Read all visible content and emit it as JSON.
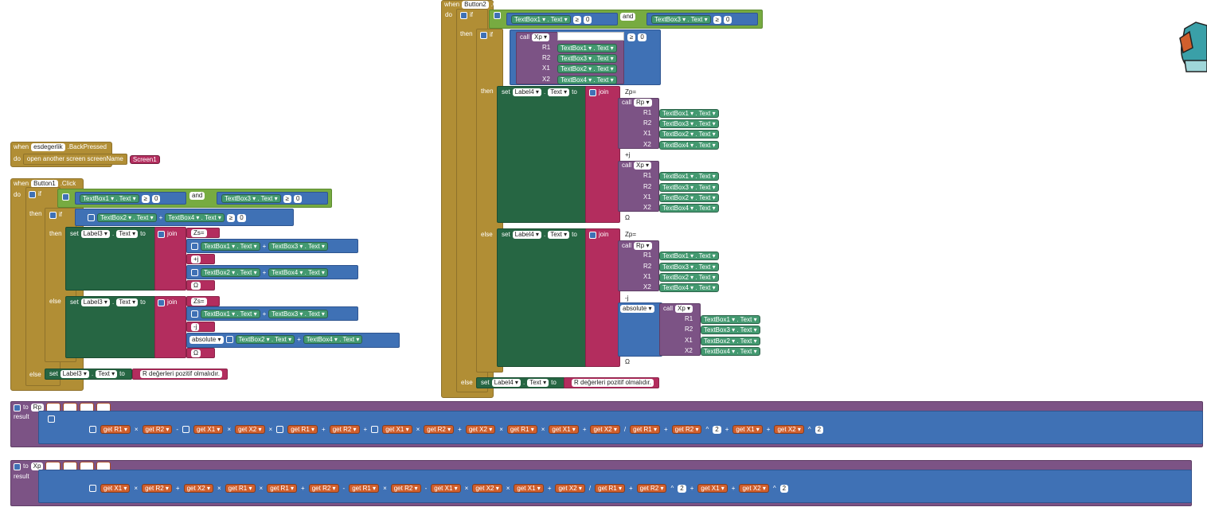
{
  "kw": {
    "when": "when",
    "do": "do",
    "if": "if",
    "then": "then",
    "else": "else",
    "set": "set",
    "to": "to",
    "join": "join",
    "call": "call",
    "result": "result",
    "and": "and",
    "gte": "≥",
    "plus": "+",
    "minus": "-",
    "times": "×",
    "div": "/",
    "pow": "^",
    "get": "get",
    "absolute": "absolute",
    "text": "Text",
    "dot": ".",
    "zero": "0",
    "two": "2",
    "open_screen": "open another screen  screenName",
    "screen1": "Screen1"
  },
  "events": {
    "back": {
      "component": "esdegerlik",
      "event": ".BackPressed"
    },
    "b1": {
      "component": "Button1",
      "event": ".Click"
    },
    "b2": {
      "component": "Button2",
      "event": ".Click"
    }
  },
  "components": {
    "tb1": "TextBox1",
    "tb2": "TextBox2",
    "tb3": "TextBox3",
    "tb4": "TextBox4",
    "label3": "Label3",
    "label4": "Label4"
  },
  "strings": {
    "zs": "Zs=",
    "zp": "Zp=",
    "plus_j": "+j",
    "minus_j": "-j",
    "zero": "Ω",
    "error": "R değerleri pozitif olmalıdır."
  },
  "procs": {
    "rp": "Rp",
    "xp": "Xp",
    "params": [
      "R1",
      "R2",
      "X1",
      "X2"
    ]
  }
}
